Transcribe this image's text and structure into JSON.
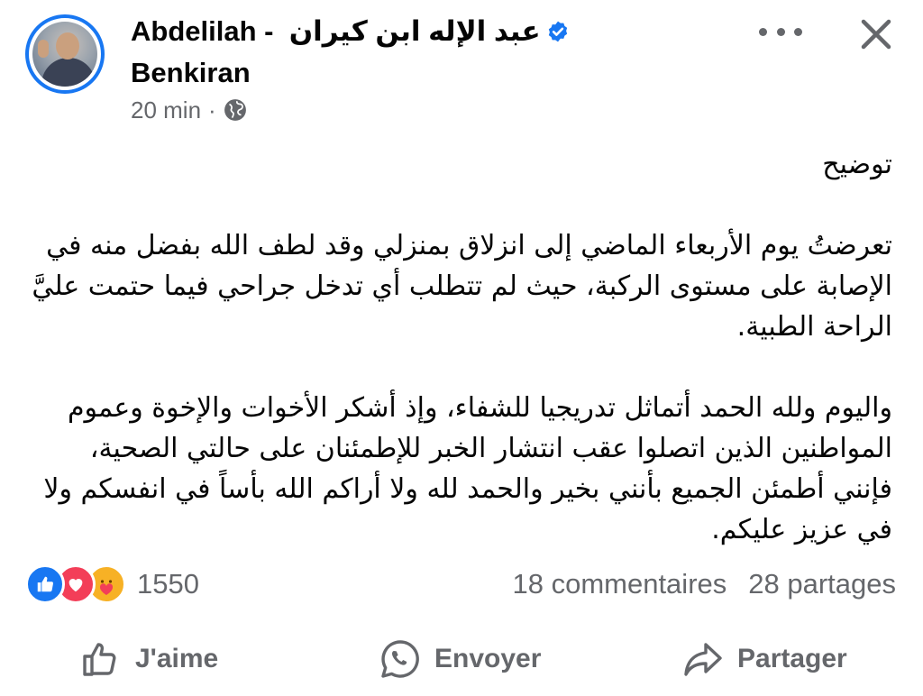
{
  "author": {
    "name_line1_latin": "Abdelilah -",
    "name_line1_arabic": "عبد الإله  ابن كيران",
    "name_line2": "Benkiran",
    "verified": true
  },
  "meta": {
    "time": "20 min",
    "separator": "·",
    "audience_icon": "globe-icon"
  },
  "header_actions": {
    "more_icon": "more-horizontal-icon",
    "close_icon": "close-icon"
  },
  "post": {
    "title": "توضيح",
    "paragraph1": "تعرضتُ يوم الأربعاء الماضي إلى انزلاق بمنزلي وقد لطف الله بفضل منه في الإصابة  على مستوى الركبة، حيث لم تتطلب أي تدخل جراحي فيما حتمت عليَّ الراحة الطبية.",
    "paragraph2": "واليوم ولله الحمد أتماثل تدريجيا للشفاء، وإذ أشكر الأخوات والإخوة وعموم المواطنين الذين اتصلوا عقب انتشار الخبر للإطمئنان على حالتي الصحية، فإنني أطمئن الجميع بأنني بخير والحمد لله ولا أراكم الله بأساً في انفسكم ولا في عزيز عليكم."
  },
  "reactions": {
    "types": [
      "like-icon",
      "love-icon",
      "care-icon"
    ],
    "count": "1550"
  },
  "stats": {
    "comments": "18 commentaires",
    "shares": "28 partages"
  },
  "actions": {
    "like": "J'aime",
    "send": "Envoyer",
    "share": "Partager"
  },
  "colors": {
    "accent": "#1877f2",
    "text": "#050505",
    "secondary": "#65676b",
    "love": "#f33e58",
    "care": "#f7b125"
  }
}
